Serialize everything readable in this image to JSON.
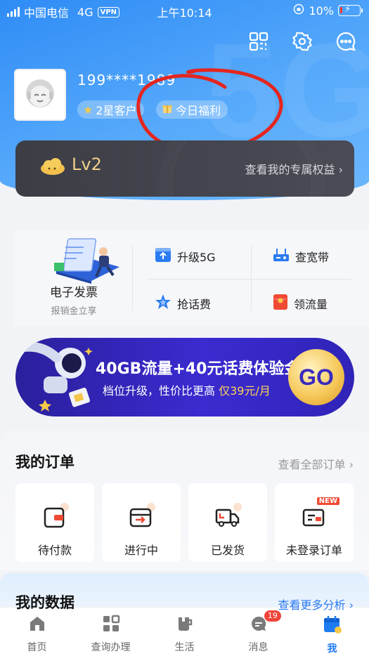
{
  "status_bar": {
    "carrier": "中国电信",
    "network": "4G",
    "vpn": "VPN",
    "time": "上午10:14",
    "battery": "10%",
    "battery_level": 0.1
  },
  "profile": {
    "phone": "199****1989",
    "badge_star": "2星客户",
    "badge_gift": "今日福利"
  },
  "level_card": {
    "level": "Lv2",
    "link": "查看我的专属权益"
  },
  "services": {
    "invoice_title": "电子发票",
    "invoice_sub": "报销金立享",
    "upgrade_5g": "升级5G",
    "check_broadband": "查宽带",
    "grab_credit": "抢话费",
    "get_data": "领流量"
  },
  "banner": {
    "title": "40GB流量+40元话费体验金",
    "subtitle_prefix": "档位升级，性价比更高",
    "subtitle_price": "仅39元/月",
    "button": "GO"
  },
  "orders": {
    "title": "我的订单",
    "link": "查看全部订单",
    "items": [
      {
        "label": "待付款"
      },
      {
        "label": "进行中"
      },
      {
        "label": "已发货"
      },
      {
        "label": "未登录订单"
      }
    ],
    "new_tag": "NEW"
  },
  "data_section": {
    "title": "我的数据",
    "link": "查看更多分析"
  },
  "tabbar": {
    "items": [
      {
        "label": "首页"
      },
      {
        "label": "查询办理"
      },
      {
        "label": "生活"
      },
      {
        "label": "消息"
      },
      {
        "label": "我"
      }
    ],
    "message_count": "19"
  }
}
